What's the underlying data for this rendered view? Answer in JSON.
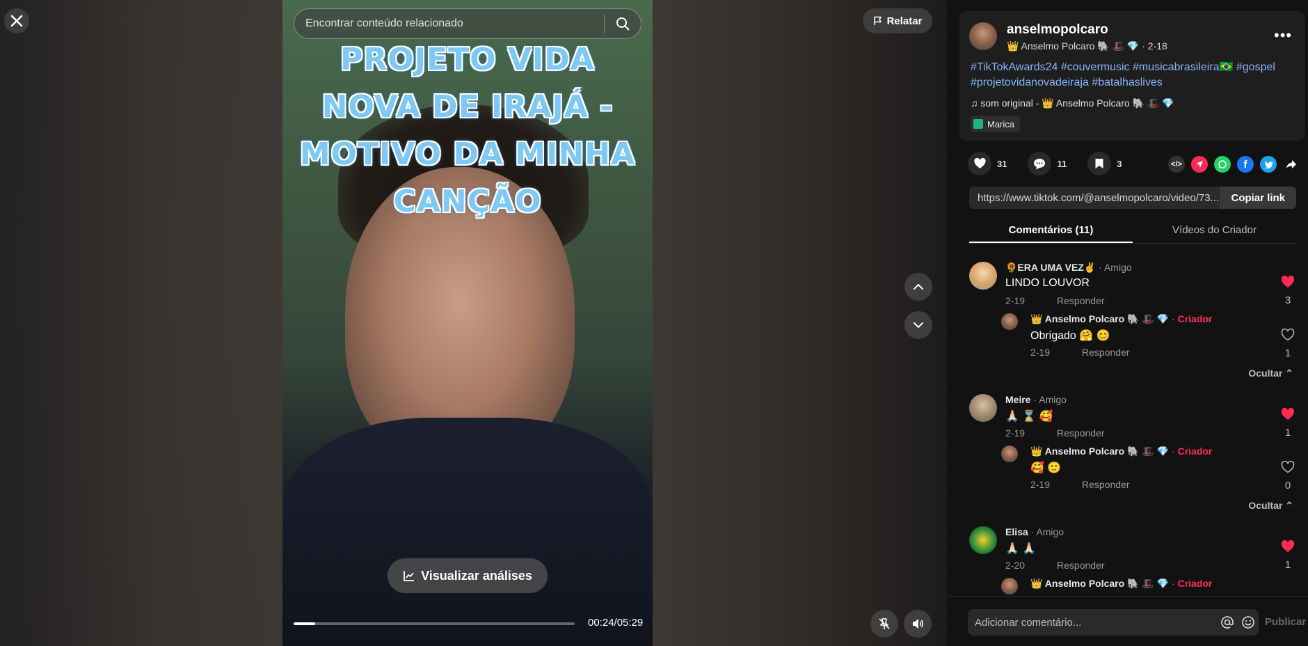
{
  "search": {
    "placeholder": "Encontrar conteúdo relacionado"
  },
  "header": {
    "report_label": "Relatar"
  },
  "video": {
    "title_lines": [
      "PROJETO VIDA",
      "NOVA DE IRAJÁ  -",
      "MOTIVO DA MINHA",
      "CANÇÃO"
    ],
    "analytics_label": "Visualizar análises",
    "progress": 0.0757,
    "time": "00:24/05:29"
  },
  "post": {
    "username": "anselmopolcaro",
    "nickname": "👑 Anselmo Polcaro 🐘 🎩 💎 · 2-18",
    "hashtags": [
      "#TikTokAwards24",
      "#couvermusic",
      "#musicabrasileira🇧🇷",
      "#gospel",
      "#projetovidanovadeiraja",
      "#batalhaslives"
    ],
    "sound": "♫  som original - 👑 Anselmo Polcaro 🐘 🎩 💎",
    "location": "Marica",
    "likes": "31",
    "comments": "11",
    "saves": "3",
    "link": "https://www.tiktok.com/@anselmopolcaro/video/73...",
    "copy_label": "Copiar link"
  },
  "tabs": {
    "comments": "Comentários (11)",
    "creator_videos": "Vídeos do Criador"
  },
  "comments": [
    {
      "name": "🌻ERA UMA VEZ✌",
      "tag": "Amigo",
      "text": "LINDO LOUVOR",
      "date": "2-19",
      "reply": "Responder",
      "likes": "3",
      "liked": true
    },
    {
      "name": "👑 Anselmo Polcaro 🐘 🎩 💎",
      "tag": "Criador",
      "text": "Obrigado 🤗 😊",
      "date": "2-19",
      "reply": "Responder",
      "likes": "1",
      "liked": false
    },
    {
      "name": "Meire",
      "tag": "Amigo",
      "text": "🙏🏻 ⌛ 🥰",
      "date": "2-19",
      "reply": "Responder",
      "likes": "1",
      "liked": true
    },
    {
      "name": "👑 Anselmo Polcaro 🐘 🎩 💎",
      "tag": "Criador",
      "text": "🥰 🙂",
      "date": "2-19",
      "reply": "Responder",
      "likes": "0",
      "liked": false
    },
    {
      "name": "Elisa",
      "tag": "Amigo",
      "text": "🙏🏻 🙏🏻",
      "date": "2-20",
      "reply": "Responder",
      "likes": "1",
      "liked": true
    },
    {
      "name": "👑 Anselmo Polcaro 🐘 🎩 💎",
      "tag": "Criador"
    }
  ],
  "hide_label": "Ocultar",
  "composer": {
    "placeholder": "Adicionar comentário...",
    "publish_label": "Publicar"
  },
  "colors": {
    "accent": "#fe2c55",
    "hashtag": "#8ab4f8",
    "panel": "#121212",
    "card": "#1e1e1e"
  }
}
